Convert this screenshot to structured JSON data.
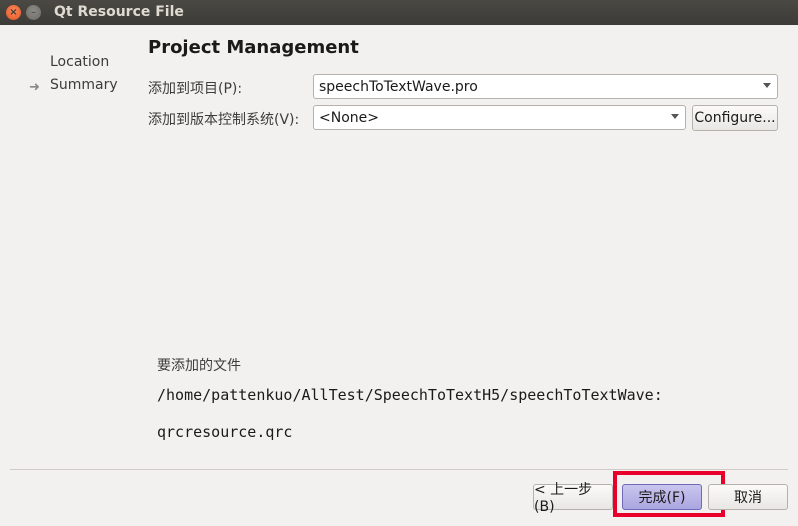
{
  "window": {
    "title": "Qt Resource File"
  },
  "sidebar": {
    "steps": [
      {
        "label": "Location"
      },
      {
        "label": "Summary"
      }
    ],
    "current_marker": "➜"
  },
  "page": {
    "title": "Project Management"
  },
  "form": {
    "add_to_project_label": "添加到项目(P):",
    "add_to_project_value": "speechToTextWave.pro",
    "add_to_vcs_label": "添加到版本控制系统(V):",
    "add_to_vcs_value": "<None>",
    "configure_label": "Configure..."
  },
  "files": {
    "heading": "要添加的文件",
    "directory": "/home/pattenkuo/AllTest/SpeechToTextH5/speechToTextWave:",
    "file": "qrcresource.qrc"
  },
  "buttons": {
    "back": "< 上一步(B)",
    "finish": "完成(F)",
    "cancel": "取消"
  },
  "colors": {
    "highlight": "#e8002b",
    "titlebar": "#3c3b37"
  }
}
